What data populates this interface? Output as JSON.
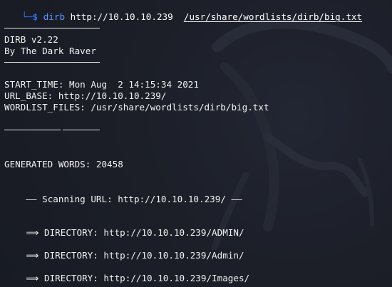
{
  "prompt": {
    "corner": "└─",
    "dollar": "$",
    "command": "dirb",
    "url": "http://10.10.10.239",
    "wordlist": "/usr/share/wordlists/dirb/big.txt"
  },
  "banner": {
    "version": "DIRB v2.22",
    "author": "By The Dark Raver"
  },
  "info": {
    "start_time": "START_TIME: Mon Aug  2 14:15:34 2021",
    "url_base": "URL_BASE: http://10.10.10.239/",
    "wordlist_files": "WORDLIST_FILES: /usr/share/wordlists/dirb/big.txt"
  },
  "generated": "GENERATED WORDS: 20458",
  "scanning": {
    "dash_left": "——",
    "text": "Scanning URL: http://10.10.10.239/",
    "dash_right": "——"
  },
  "results": [
    {
      "arrow": "⟹",
      "text": "DIRECTORY: http://10.10.10.239/ADMIN/"
    },
    {
      "arrow": "⟹",
      "text": "DIRECTORY: http://10.10.10.239/Admin/"
    },
    {
      "arrow": "⟹",
      "text": "DIRECTORY: http://10.10.10.239/Images/"
    }
  ],
  "colors": {
    "background": "#1b1e27",
    "prompt_accent": "#2f6ee8",
    "command": "#5b95ff",
    "text": "#f2f2f2"
  },
  "icons": {
    "background_watermark": "kali-dragon-icon"
  }
}
